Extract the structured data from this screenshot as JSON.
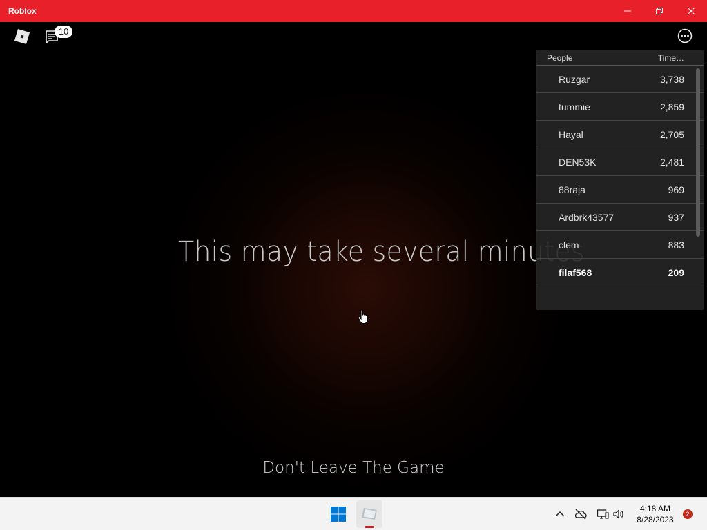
{
  "window": {
    "title": "Roblox"
  },
  "topbar": {
    "chat_badge": "10"
  },
  "game": {
    "main_message": "This may take several minutes",
    "sub_message": "Don't Leave The Game"
  },
  "leaderboard": {
    "col_people": "People",
    "col_stat": "Time…",
    "rows": [
      {
        "name": "Ruzgar",
        "score": "3,738"
      },
      {
        "name": "tummie",
        "score": "2,859"
      },
      {
        "name": "Hayal",
        "score": "2,705"
      },
      {
        "name": "DEN53K",
        "score": "2,481"
      },
      {
        "name": "88raja",
        "score": "969"
      },
      {
        "name": "Ardbrk43577",
        "score": "937"
      },
      {
        "name": "clem",
        "score": "883"
      },
      {
        "name": "filaf568",
        "score": "209"
      }
    ]
  },
  "taskbar": {
    "time": "4:18 AM",
    "date": "8/28/2023",
    "notification_count": "2"
  },
  "colors": {
    "titlebar": "#e8202a",
    "taskbar": "#f3f3f3",
    "accent_blue": "#0078d4"
  }
}
